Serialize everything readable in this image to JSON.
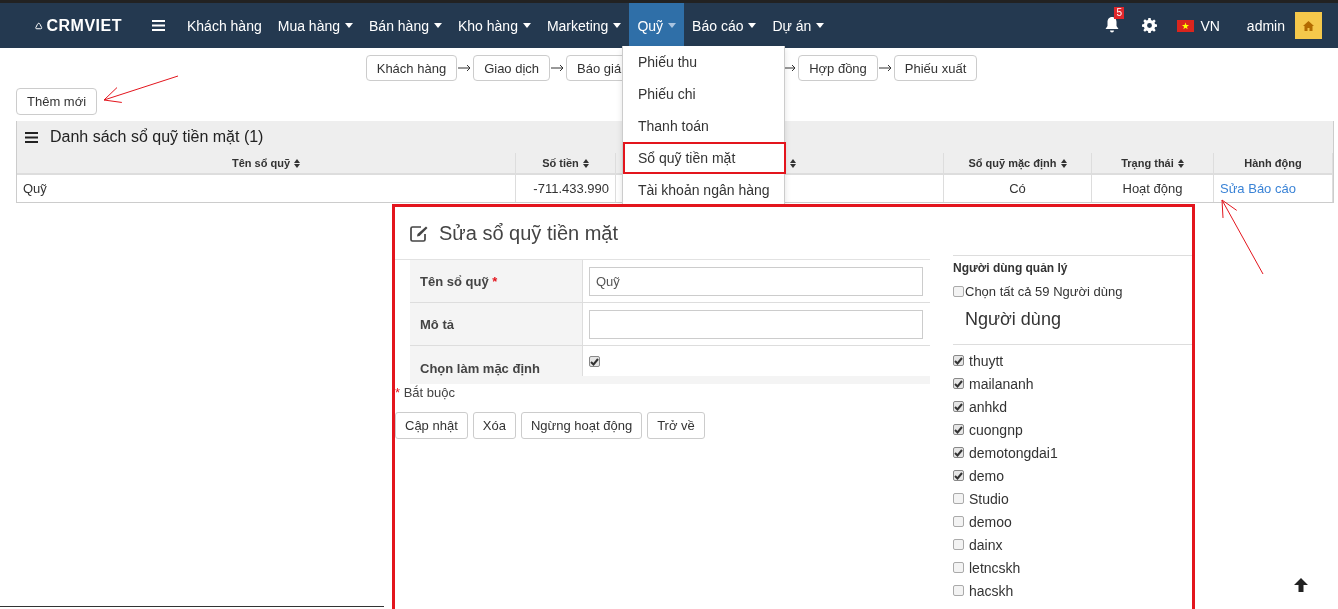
{
  "navbar": {
    "brand": "CRMVIET",
    "menu": [
      {
        "label": "Khách hàng",
        "caret": false,
        "selected": false
      },
      {
        "label": "Mua hàng",
        "caret": true,
        "selected": false
      },
      {
        "label": "Bán hàng",
        "caret": true,
        "selected": false
      },
      {
        "label": "Kho hàng",
        "caret": true,
        "selected": false
      },
      {
        "label": "Marketing",
        "caret": true,
        "selected": false
      },
      {
        "label": "Quỹ",
        "caret": true,
        "selected": true
      },
      {
        "label": "Báo cáo",
        "caret": true,
        "selected": false
      },
      {
        "label": "Dự án",
        "caret": true,
        "selected": false
      }
    ],
    "notification_count": "5",
    "language": "VN",
    "user": "admin"
  },
  "flow_steps": [
    {
      "kind": "step",
      "label": "Khách hàng"
    },
    {
      "kind": "step",
      "label": "Giao dịch"
    },
    {
      "kind": "step",
      "label": "Báo giá"
    },
    {
      "kind": "covered"
    },
    {
      "kind": "step",
      "label": "Hợp đồng"
    },
    {
      "kind": "step",
      "label": "Phiếu xuất"
    }
  ],
  "add_button": "Thêm mới",
  "list_panel": {
    "title": "Danh sách sổ quỹ tiền mặt (1)",
    "columns": [
      {
        "label": "Tên sổ quỹ",
        "sortable": true
      },
      {
        "label": "Số tiền",
        "sortable": true
      },
      {
        "sortable": true
      },
      {
        "label": "Sổ quỹ mặc định",
        "sortable": true
      },
      {
        "label": "Trạng thái",
        "sortable": true
      },
      {
        "label": "Hành động",
        "sortable": false
      }
    ],
    "rows": [
      {
        "cells": [
          "Quỹ",
          "-711.433.990",
          null,
          "Có",
          "Hoạt động"
        ],
        "action_link": "Sửa Báo cáo"
      }
    ]
  },
  "fund_menu": {
    "items": [
      {
        "label": "Phiếu thu",
        "selected": false
      },
      {
        "label": "Phiếu chi",
        "selected": false
      },
      {
        "label": "Thanh toán",
        "selected": false
      },
      {
        "label": "Sổ quỹ tiền mặt",
        "selected": true
      },
      {
        "label": "Tài khoản ngân hàng",
        "selected": false
      }
    ]
  },
  "edit_form": {
    "title": "Sửa sổ quỹ tiền mặt",
    "fields": [
      {
        "kind": "text",
        "label": "Tên sổ quỹ",
        "required_mark": "*",
        "value": "Quỹ"
      },
      {
        "kind": "textarea",
        "label": "Mô tả"
      },
      {
        "kind": "checkbox",
        "label": "Chọn làm mặc định",
        "checked": true
      }
    ],
    "required_note": {
      "mark": "*",
      "text": "Bắt buộc"
    },
    "buttons": [
      "Cập nhật",
      "Xóa",
      "Ngừng hoạt động",
      "Trở về"
    ],
    "managers": {
      "heading": "Người dùng quản lý",
      "select_all": {
        "label": "Chọn tất cả 59 Người dùng",
        "checked": false
      },
      "list_heading": "Người dùng",
      "users": [
        {
          "name": "thuytt",
          "checked": true
        },
        {
          "name": "mailananh",
          "checked": true
        },
        {
          "name": "anhkd",
          "checked": true
        },
        {
          "name": "cuongnp",
          "checked": true
        },
        {
          "name": "demotongdai1",
          "checked": true
        },
        {
          "name": "demo",
          "checked": true
        },
        {
          "name": "Studio",
          "checked": false
        },
        {
          "name": "demoo",
          "checked": false
        },
        {
          "name": "dainx",
          "checked": false
        },
        {
          "name": "letncskh",
          "checked": false
        },
        {
          "name": "hacskh",
          "checked": false
        }
      ]
    }
  },
  "annotations": [
    {
      "kind": "arrow"
    },
    {
      "kind": "arrow"
    },
    {
      "kind": "frame"
    }
  ]
}
